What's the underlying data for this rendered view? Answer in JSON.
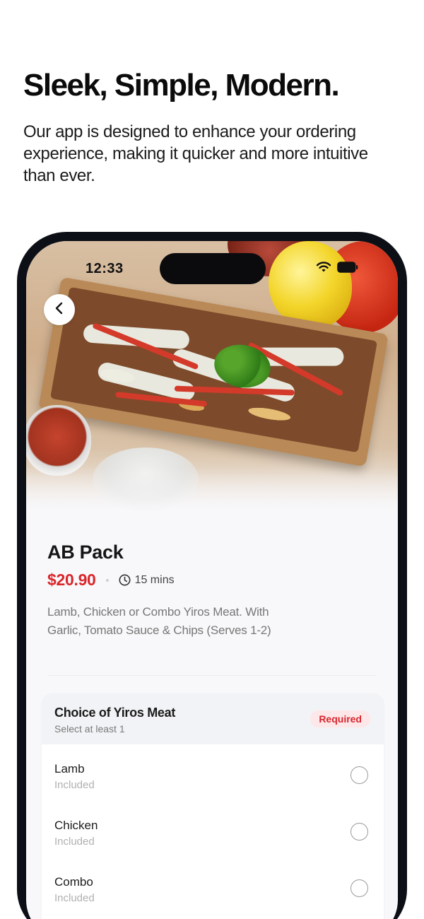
{
  "marketing": {
    "headline": "Sleek, Simple, Modern.",
    "subtext": "Our app is designed to enhance your ordering experience, making it quicker and more intuitive than ever."
  },
  "status_bar": {
    "time": "12:33",
    "icons": [
      "wifi-icon",
      "battery-icon"
    ]
  },
  "navigation": {
    "back_icon": "chevron-left-icon"
  },
  "product": {
    "name": "AB Pack",
    "price": "$20.90",
    "prep_time": "15 mins",
    "description": "Lamb, Chicken or Combo Yiros Meat. With Garlic, Tomato Sauce & Chips (Serves 1-2)"
  },
  "options_group": {
    "title": "Choice of Yiros Meat",
    "subtitle": "Select at least 1",
    "badge": "Required",
    "items": [
      {
        "label": "Lamb",
        "sub": "Included"
      },
      {
        "label": "Chicken",
        "sub": "Included"
      },
      {
        "label": "Combo",
        "sub": "Included"
      }
    ]
  },
  "colors": {
    "price_red": "#d9262c",
    "badge_bg": "#fde7e8",
    "phone_frame": "#0d0f16"
  }
}
